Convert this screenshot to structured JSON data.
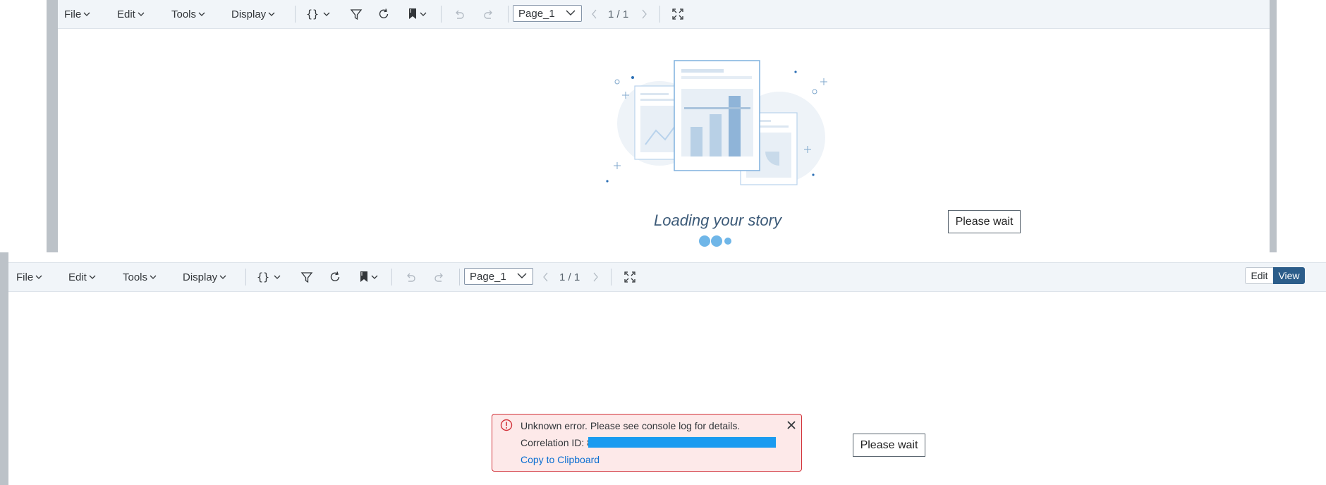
{
  "top_toolbar": {
    "menus": [
      {
        "label": "File"
      },
      {
        "label": "Edit"
      },
      {
        "label": "Tools"
      },
      {
        "label": "Display"
      }
    ],
    "page_select": "Page_1",
    "page_count": "1 / 1"
  },
  "loading": {
    "title": "Loading your story"
  },
  "wait_top": "Please wait",
  "bottom_toolbar": {
    "menus": [
      {
        "label": "File"
      },
      {
        "label": "Edit"
      },
      {
        "label": "Tools"
      },
      {
        "label": "Display"
      }
    ],
    "page_select": "Page_1",
    "page_count": "1 / 1",
    "mode": {
      "edit": "Edit",
      "view": "View"
    }
  },
  "error": {
    "message": "Unknown error. Please see console log for details.",
    "correlation_label": "Correlation ID: 8",
    "copy_link": "Copy to Clipboard"
  },
  "wait_bottom": "Please wait",
  "colors": {
    "accent": "#1a9bf0",
    "error_border": "#d2323a",
    "error_bg": "#fde9e9",
    "view_active": "#2c5d8a"
  }
}
